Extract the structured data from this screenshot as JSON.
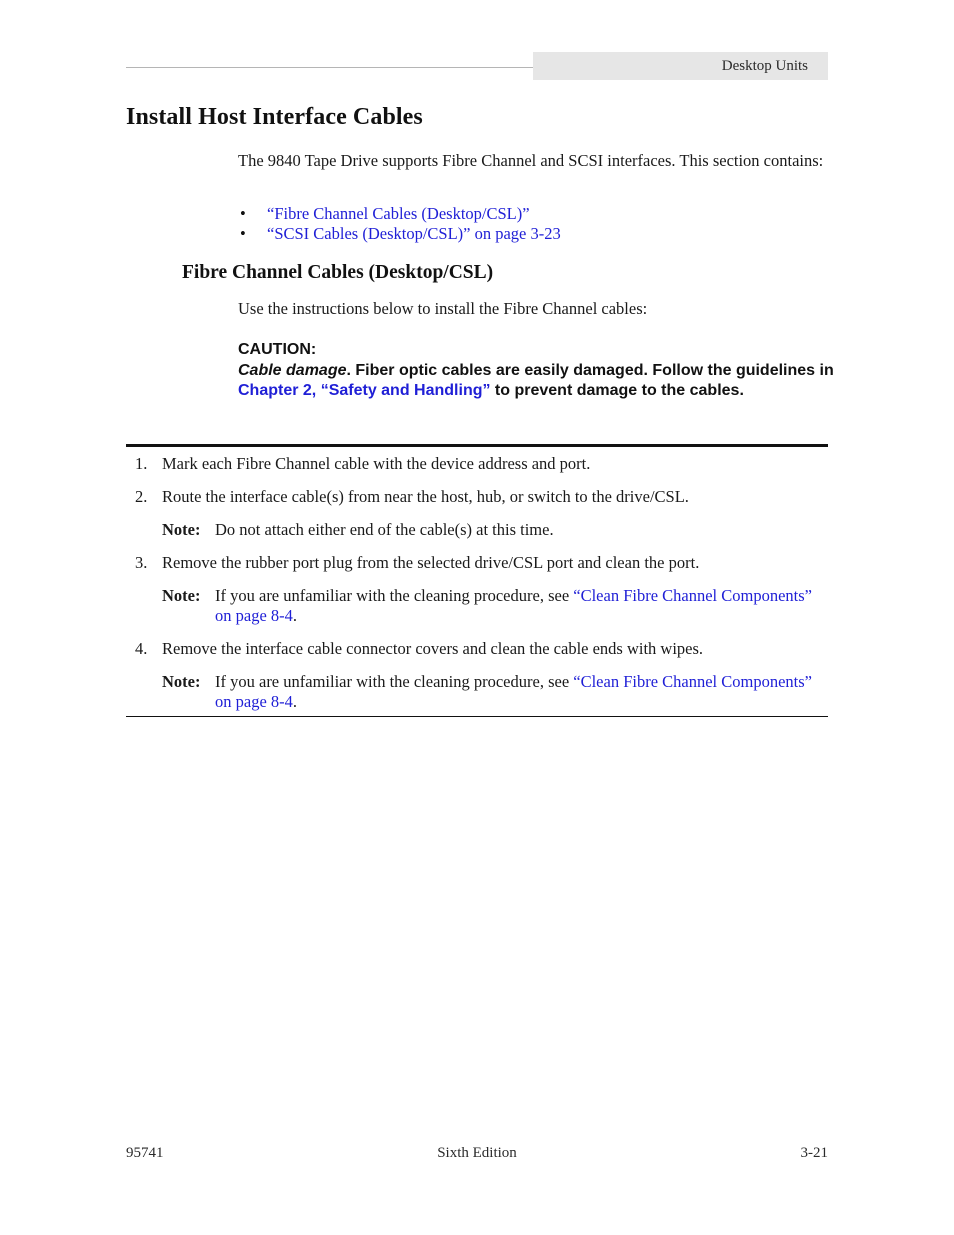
{
  "header": {
    "running_title": "Desktop Units"
  },
  "section": {
    "title": "Install Host Interface Cables",
    "intro": "The 9840 Tape Drive supports Fibre Channel and SCSI interfaces. This section contains:",
    "links": [
      {
        "label": "“Fibre Channel Cables (Desktop/CSL)”"
      },
      {
        "label": "“SCSI Cables (Desktop/CSL)” on page 3-23"
      }
    ]
  },
  "subsection": {
    "title": "Fibre Channel Cables (Desktop/CSL)",
    "intro": "Use the instructions below to install the Fibre Channel cables:",
    "caution": {
      "label": "CAUTION:",
      "emphasis": "Cable damage",
      "text_before_link": ". Fiber optic cables are easily damaged. Follow the guidelines in ",
      "link": "Chapter 2, “Safety and Handling”",
      "text_after_link": " to prevent damage to the cables."
    },
    "steps": [
      {
        "num": "1.",
        "text": "Mark each Fibre Channel cable with the device address and port."
      },
      {
        "num": "2.",
        "text": "Route the interface cable(s) from near the host, hub, or switch to the drive/CSL.",
        "note": {
          "label": "Note:",
          "text": "Do not attach either end of the cable(s) at this time."
        }
      },
      {
        "num": "3.",
        "text": "Remove the rubber port plug from the selected drive/CSL port and clean the port.",
        "note": {
          "label": "Note:",
          "text": "If you are unfamiliar with the cleaning procedure, see ",
          "link": "“Clean Fibre Channel Components” on page 8-4",
          "after": "."
        }
      },
      {
        "num": "4.",
        "text": "Remove the interface cable connector covers and clean the cable ends with wipes.",
        "note": {
          "label": "Note:",
          "text": "If you are unfamiliar with the cleaning procedure, see ",
          "link": "“Clean Fibre Channel Components” on page 8-4",
          "after": "."
        }
      }
    ]
  },
  "footer": {
    "doc_number": "95741",
    "edition": "Sixth Edition",
    "page": "3-21"
  }
}
